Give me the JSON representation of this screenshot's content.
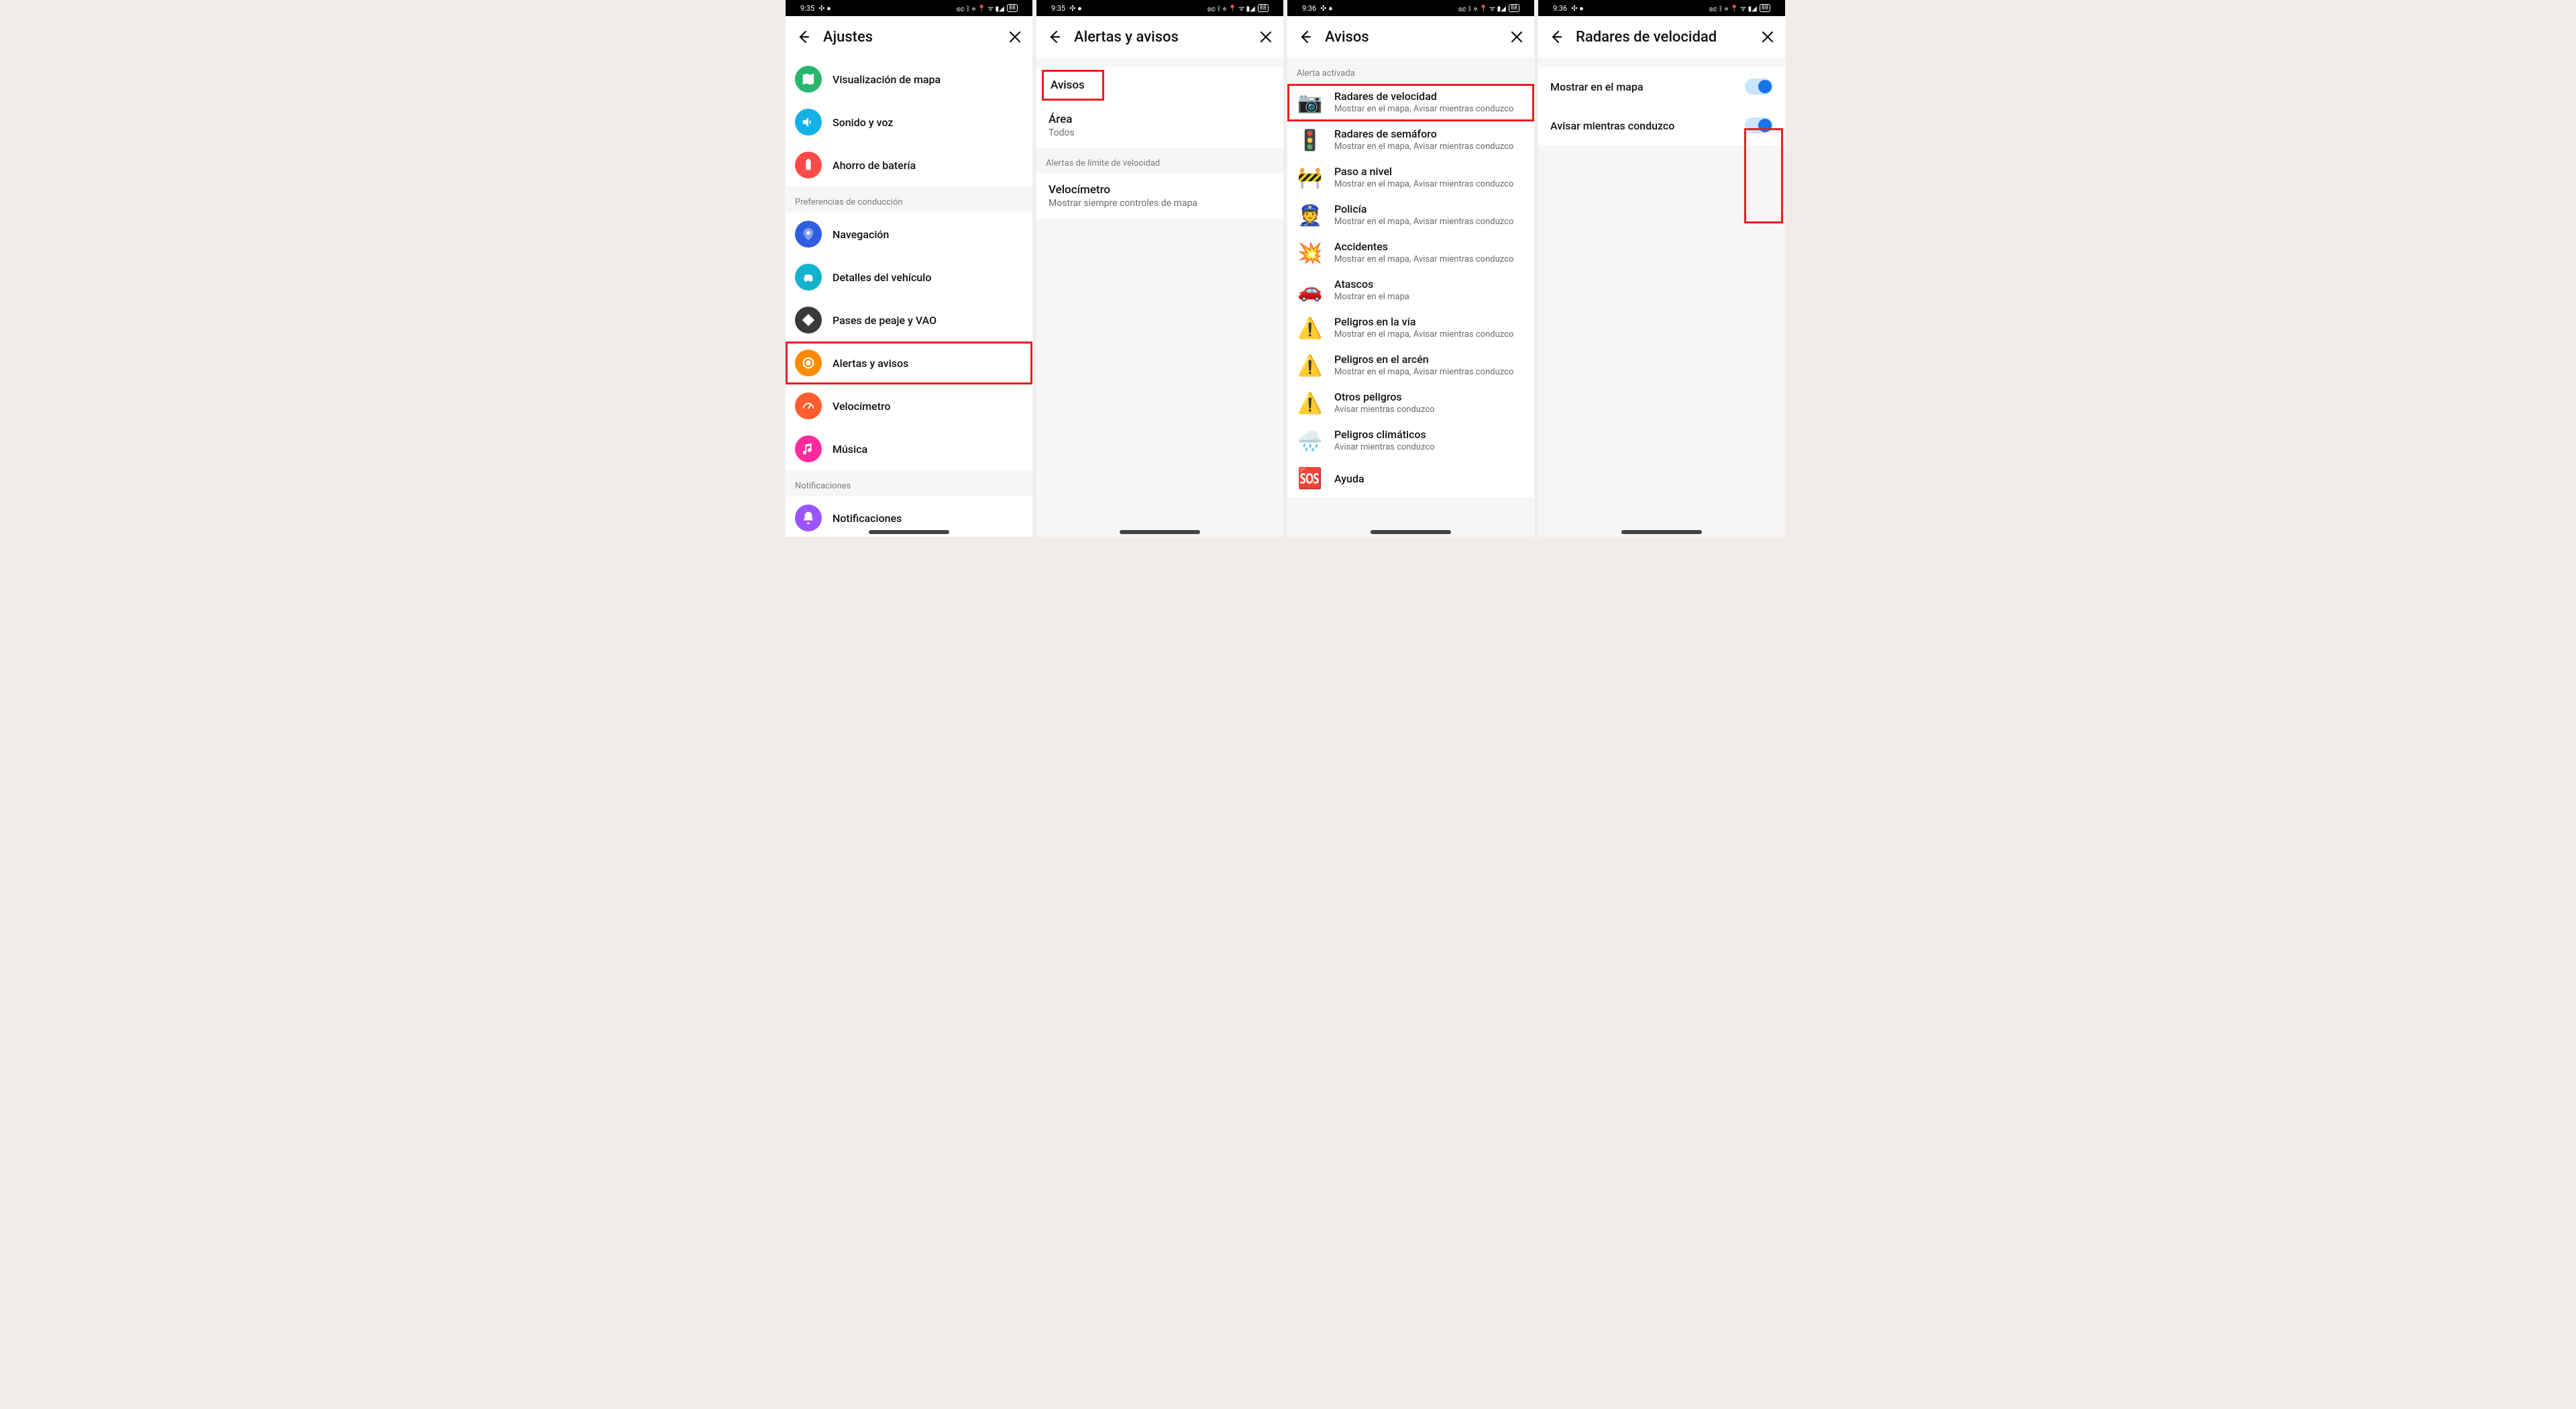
{
  "status": {
    "time1": "9:35",
    "time2": "9:36",
    "battery": "88"
  },
  "screen1": {
    "title": "Ajustes",
    "items": [
      {
        "label": "Visualización de mapa",
        "color": "green",
        "glyph": "map"
      },
      {
        "label": "Sonido y voz",
        "color": "blue",
        "glyph": "sound"
      },
      {
        "label": "Ahorro de batería",
        "color": "red",
        "glyph": "battery"
      }
    ],
    "section_driving": "Preferencias de conducción",
    "driving": [
      {
        "label": "Navegación",
        "color": "navy",
        "glyph": "nav"
      },
      {
        "label": "Detalles del vehículo",
        "color": "teal",
        "glyph": "car"
      },
      {
        "label": "Pases de peaje y VAO",
        "color": "dark",
        "glyph": "toll"
      },
      {
        "label": "Alertas y avisos",
        "color": "orange",
        "glyph": "alert",
        "highlight": true
      },
      {
        "label": "Velocímetro",
        "color": "orangedeep",
        "glyph": "speed"
      },
      {
        "label": "Música",
        "color": "pink",
        "glyph": "music"
      }
    ],
    "section_notif": "Notificaciones",
    "notif": [
      {
        "label": "Notificaciones",
        "color": "purple",
        "glyph": "bell"
      }
    ]
  },
  "screen2": {
    "title": "Alertas y avisos",
    "rows": [
      {
        "label": "Avisos",
        "highlight": true
      },
      {
        "label": "Área",
        "sub": "Todos"
      }
    ],
    "section_speed": "Alertas de límite de velocidad",
    "speed_rows": [
      {
        "label": "Velocímetro",
        "sub": "Mostrar siempre controles de mapa"
      }
    ]
  },
  "screen3": {
    "title": "Avisos",
    "section_active": "Alerta activada",
    "items": [
      {
        "label": "Radares de velocidad",
        "sub": "Mostrar en el mapa, Avisar mientras conduzco",
        "emoji": "📷",
        "highlight": true
      },
      {
        "label": "Radares de semáforo",
        "sub": "Mostrar en el mapa, Avisar mientras conduzco",
        "emoji": "🚦"
      },
      {
        "label": "Paso a nivel",
        "sub": "Mostrar en el mapa, Avisar mientras conduzco",
        "emoji": "🚧"
      },
      {
        "label": "Policía",
        "sub": "Mostrar en el mapa, Avisar mientras conduzco",
        "emoji": "👮"
      },
      {
        "label": "Accidentes",
        "sub": "Mostrar en el mapa, Avisar mientras conduzco",
        "emoji": "💥"
      },
      {
        "label": "Atascos",
        "sub": "Mostrar en el mapa",
        "emoji": "🚗"
      },
      {
        "label": "Peligros en la vía",
        "sub": "Mostrar en el mapa, Avisar mientras conduzco",
        "emoji": "⚠️"
      },
      {
        "label": "Peligros en el arcén",
        "sub": "Mostrar en el mapa, Avisar mientras conduzco",
        "emoji": "⚠️"
      },
      {
        "label": "Otros peligros",
        "sub": "Avisar mientras conduzco",
        "emoji": "⚠️"
      },
      {
        "label": "Peligros climáticos",
        "sub": "Avisar mientras conduzco",
        "emoji": "🌧️"
      },
      {
        "label": "Ayuda",
        "sub": "",
        "emoji": "🆘"
      }
    ]
  },
  "screen4": {
    "title": "Radares de velocidad",
    "toggles": [
      {
        "label": "Mostrar en el mapa",
        "on": true
      },
      {
        "label": "Avisar mientras conduzco",
        "on": true
      }
    ]
  }
}
